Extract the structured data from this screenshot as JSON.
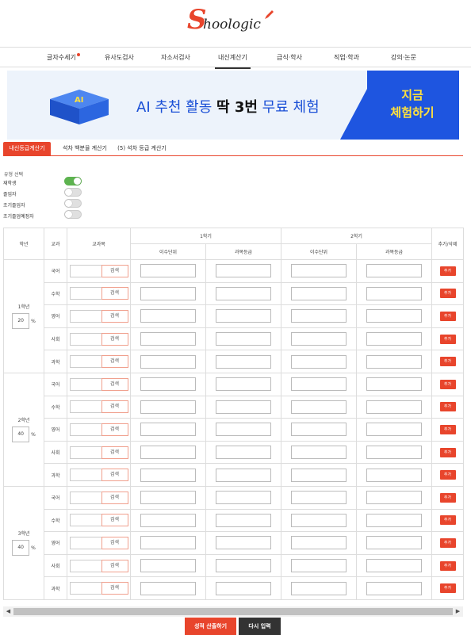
{
  "logo": {
    "initial": "S",
    "rest": "hoologic"
  },
  "nav": [
    "글자수세기",
    "유사도검사",
    "자소서검사",
    "내신계산기",
    "급식·학사",
    "직업·학과",
    "강의·논문"
  ],
  "banner": {
    "prefix": "AI 추천 활동 ",
    "highlight": "딱 3번",
    "suffix": " 무료 체험",
    "cta_line1": "지금",
    "cta_line2": "체험하기",
    "badge": "AI"
  },
  "tabs": [
    "내신등급계산기",
    "석차 백분율 계산기",
    "(5) 석차 등급 계산기"
  ],
  "type_section": {
    "title": "유형 선택",
    "options": [
      {
        "label": "재학생",
        "on": true
      },
      {
        "label": "졸업자",
        "on": false
      },
      {
        "label": "조기졸업자",
        "on": false
      },
      {
        "label": "조기졸업예정자",
        "on": false
      }
    ]
  },
  "table": {
    "headers": {
      "grade": "학년",
      "subject_group": "교과",
      "subject": "교과목",
      "sem1": "1학기",
      "sem2": "2학기",
      "credit": "이수단위",
      "rank": "과목등급",
      "action": "추가/삭제"
    },
    "search_label": "검색",
    "add_label": "추가",
    "pct_symbol": "%",
    "grades": [
      {
        "label": "1학년",
        "weight": "20"
      },
      {
        "label": "2학년",
        "weight": "40"
      },
      {
        "label": "3학년",
        "weight": "40"
      }
    ],
    "subjects": [
      "국어",
      "수학",
      "영어",
      "사회",
      "과학"
    ]
  },
  "scrollbar": {
    "left_arrow": "◀",
    "right_arrow": "▶"
  },
  "buttons": {
    "calculate": "성적 산출하기",
    "reset": "다시 입력"
  }
}
